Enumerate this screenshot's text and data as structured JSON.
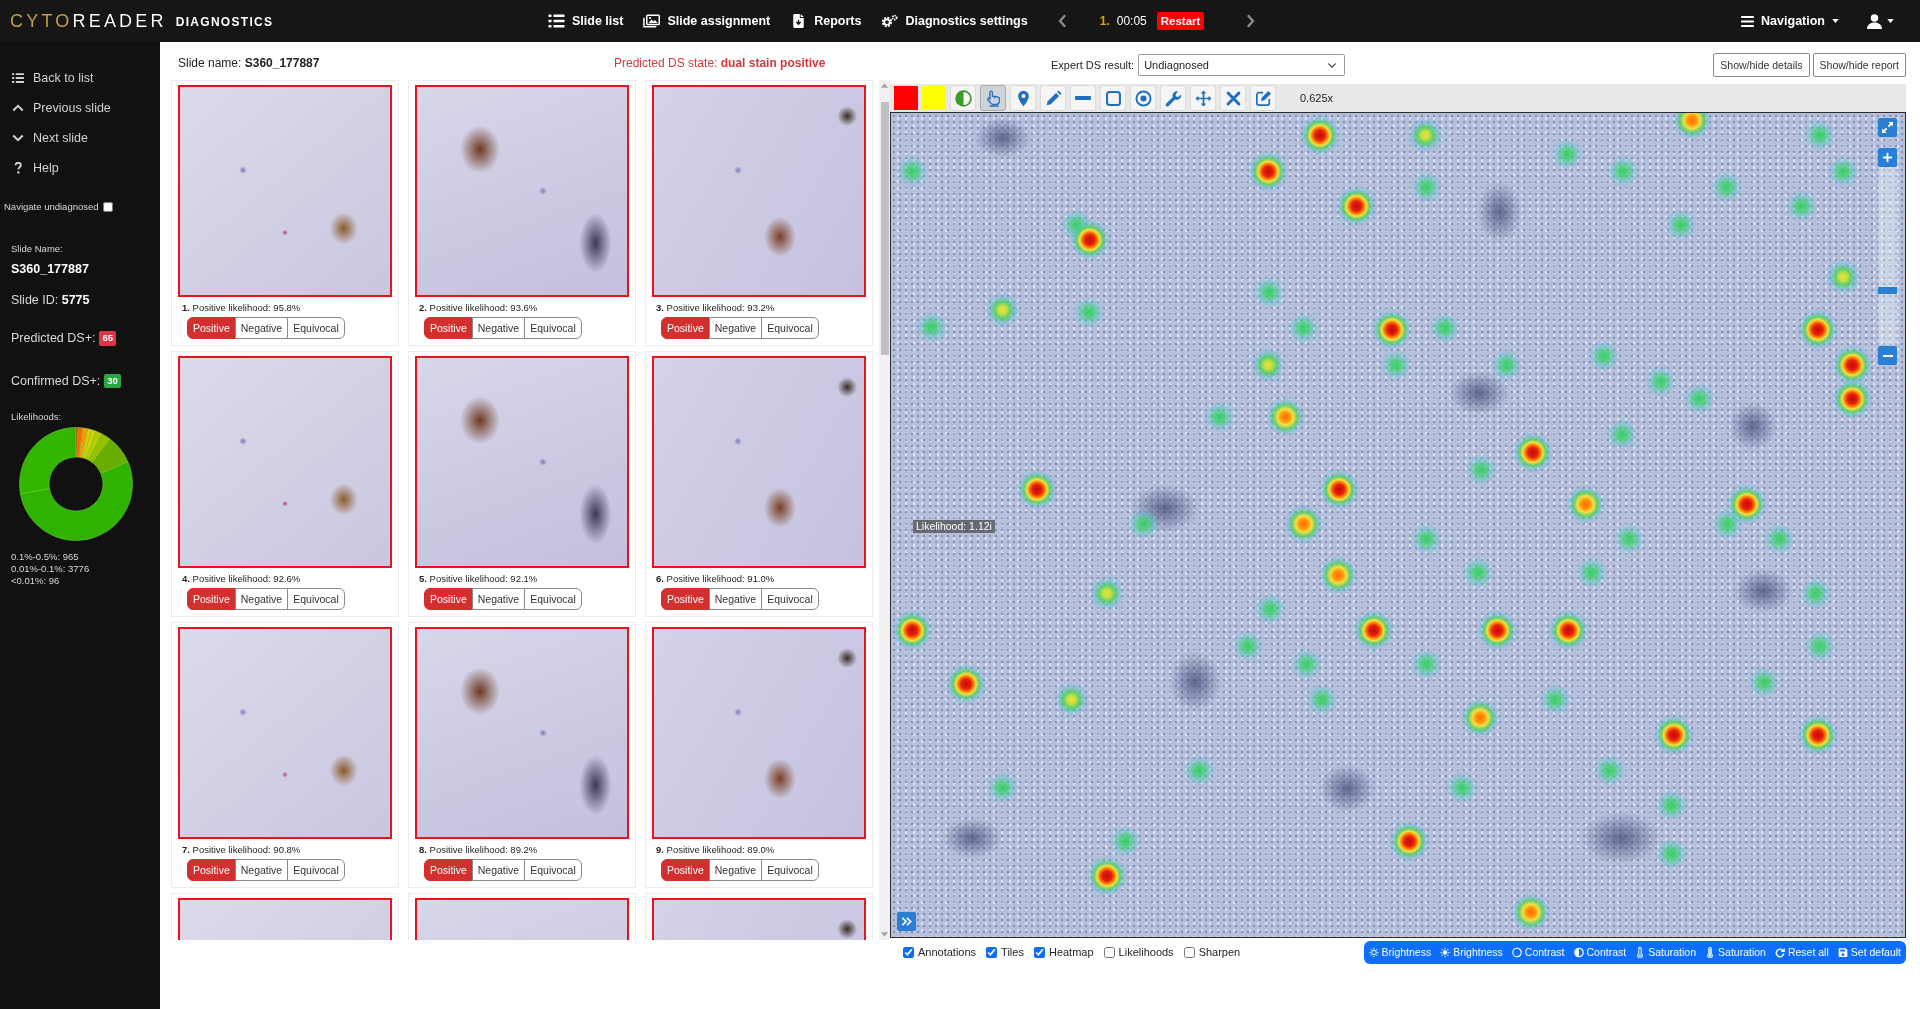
{
  "navbar": {
    "logo": {
      "accent": "CYTO",
      "main": "READER",
      "subtitle": "DIAGNOSTICS"
    },
    "links": [
      {
        "label": "Slide list"
      },
      {
        "label": "Slide assignment"
      },
      {
        "label": "Reports"
      },
      {
        "label": "Diagnostics settings"
      }
    ],
    "timer": {
      "index": "1.",
      "time": "00:05",
      "restart": "Restart"
    },
    "navigation_menu": "Navigation"
  },
  "sidebar": {
    "items": [
      "Back to list",
      "Previous slide",
      "Next slide",
      "Help"
    ],
    "navigate_undiagnosed": {
      "label": "Navigate undiagnosed",
      "checked": false
    },
    "slide_name_label": "Slide Name:",
    "slide_name": "S360_177887",
    "slide_id_text": "Slide ID: **5775**",
    "counts": [
      {
        "label": "Predicted DS+:",
        "value": "65",
        "color": "#dc3545"
      },
      {
        "label": "Confirmed DS+:",
        "value": "30",
        "color": "#28a745"
      }
    ],
    "likelihoods_label": "Likelihoods:",
    "likelihood_counts": [
      "0.1%-0.5%: 965",
      "0.01%-0.1%: 3776",
      "<0.01%: 96"
    ]
  },
  "tiles_panel": {
    "slide_name_text": "Slide name: **S360_177887**",
    "predicted_state_text": "Predicted DS state: **dual stain positive**",
    "tiles": [
      {
        "kind": "full",
        "label": "**1.** Positive likelihood: 95.8%",
        "decisions": [
          {
            "label": "Positive",
            "selected": true
          },
          {
            "label": "Negative",
            "selected": false
          },
          {
            "label": "Equivocal",
            "selected": false
          }
        ]
      },
      {
        "kind": "full",
        "label": "**2.** Positive likelihood: 93.6%",
        "decisions": [
          {
            "label": "Positive",
            "selected": true
          },
          {
            "label": "Negative",
            "selected": false
          },
          {
            "label": "Equivocal",
            "selected": false
          }
        ]
      },
      {
        "kind": "full",
        "label": "**3.** Positive likelihood: 93.2%",
        "decisions": [
          {
            "label": "Positive",
            "selected": true
          },
          {
            "label": "Negative",
            "selected": false
          },
          {
            "label": "Equivocal",
            "selected": false
          }
        ]
      },
      {
        "kind": "full",
        "label": "**4.** Positive likelihood: 92.6%",
        "decisions": [
          {
            "label": "Positive",
            "selected": true
          },
          {
            "label": "Negative",
            "selected": false
          },
          {
            "label": "Equivocal",
            "selected": false
          }
        ]
      },
      {
        "kind": "full",
        "label": "**5.** Positive likelihood: 92.1%",
        "decisions": [
          {
            "label": "Positive",
            "selected": true
          },
          {
            "label": "Negative",
            "selected": false
          },
          {
            "label": "Equivocal",
            "selected": false
          }
        ]
      },
      {
        "kind": "full",
        "label": "**6.** Positive likelihood: 91.0%",
        "decisions": [
          {
            "label": "Positive",
            "selected": true
          },
          {
            "label": "Negative",
            "selected": false
          },
          {
            "label": "Equivocal",
            "selected": false
          }
        ]
      },
      {
        "kind": "full",
        "label": "**7.** Positive likelihood: 90.8%",
        "decisions": [
          {
            "label": "Positive",
            "selected": true
          },
          {
            "label": "Negative",
            "selected": false
          },
          {
            "label": "Equivocal",
            "selected": false
          }
        ]
      },
      {
        "kind": "full",
        "label": "**8.** Positive likelihood: 89.2%",
        "decisions": [
          {
            "label": "Positive",
            "selected": true
          },
          {
            "label": "Negative",
            "selected": false
          },
          {
            "label": "Equivocal",
            "selected": false
          }
        ]
      },
      {
        "kind": "full",
        "label": "**9.** Positive likelihood: 89.0%",
        "decisions": [
          {
            "label": "Positive",
            "selected": true
          },
          {
            "label": "Negative",
            "selected": false
          },
          {
            "label": "Equivocal",
            "selected": false
          }
        ]
      },
      {
        "kind": "cut"
      },
      {
        "kind": "cut"
      },
      {
        "kind": "cut"
      }
    ]
  },
  "viewer": {
    "expert_label": "Expert DS result:",
    "expert_value": "Undiagnosed",
    "header_buttons": [
      "Show/hide details",
      "Show/hide report"
    ],
    "tools": [
      {
        "kind": "swatch",
        "color": "#ff0000"
      },
      {
        "kind": "swatch",
        "color": "#ffff00"
      },
      {
        "kind": "tool",
        "selected": false
      },
      {
        "kind": "tool",
        "selected": true
      },
      {
        "kind": "tool",
        "selected": false
      },
      {
        "kind": "tool",
        "selected": false
      },
      {
        "kind": "tool",
        "selected": false
      },
      {
        "kind": "tool",
        "selected": false
      },
      {
        "kind": "tool",
        "selected": false
      },
      {
        "kind": "tool",
        "selected": false
      },
      {
        "kind": "tool",
        "selected": false
      },
      {
        "kind": "tool",
        "selected": false
      },
      {
        "kind": "tool",
        "selected": false
      }
    ],
    "zoom": "0.625x",
    "tooltip": "Likelihood: 1.12i",
    "zoom_slider": {
      "level": 0.3
    },
    "layers": [
      {
        "label": "Annotations",
        "checked": true
      },
      {
        "label": "Tiles",
        "checked": true
      },
      {
        "label": "Heatmap",
        "checked": true
      },
      {
        "label": "Likelihoods",
        "checked": false
      },
      {
        "label": "Sharpen",
        "checked": false
      }
    ],
    "adjustments": [
      "Brightness",
      "Brightness",
      "Contrast",
      "Contrast",
      "Saturation",
      "Saturation",
      "Reset all",
      "Set default"
    ]
  }
}
